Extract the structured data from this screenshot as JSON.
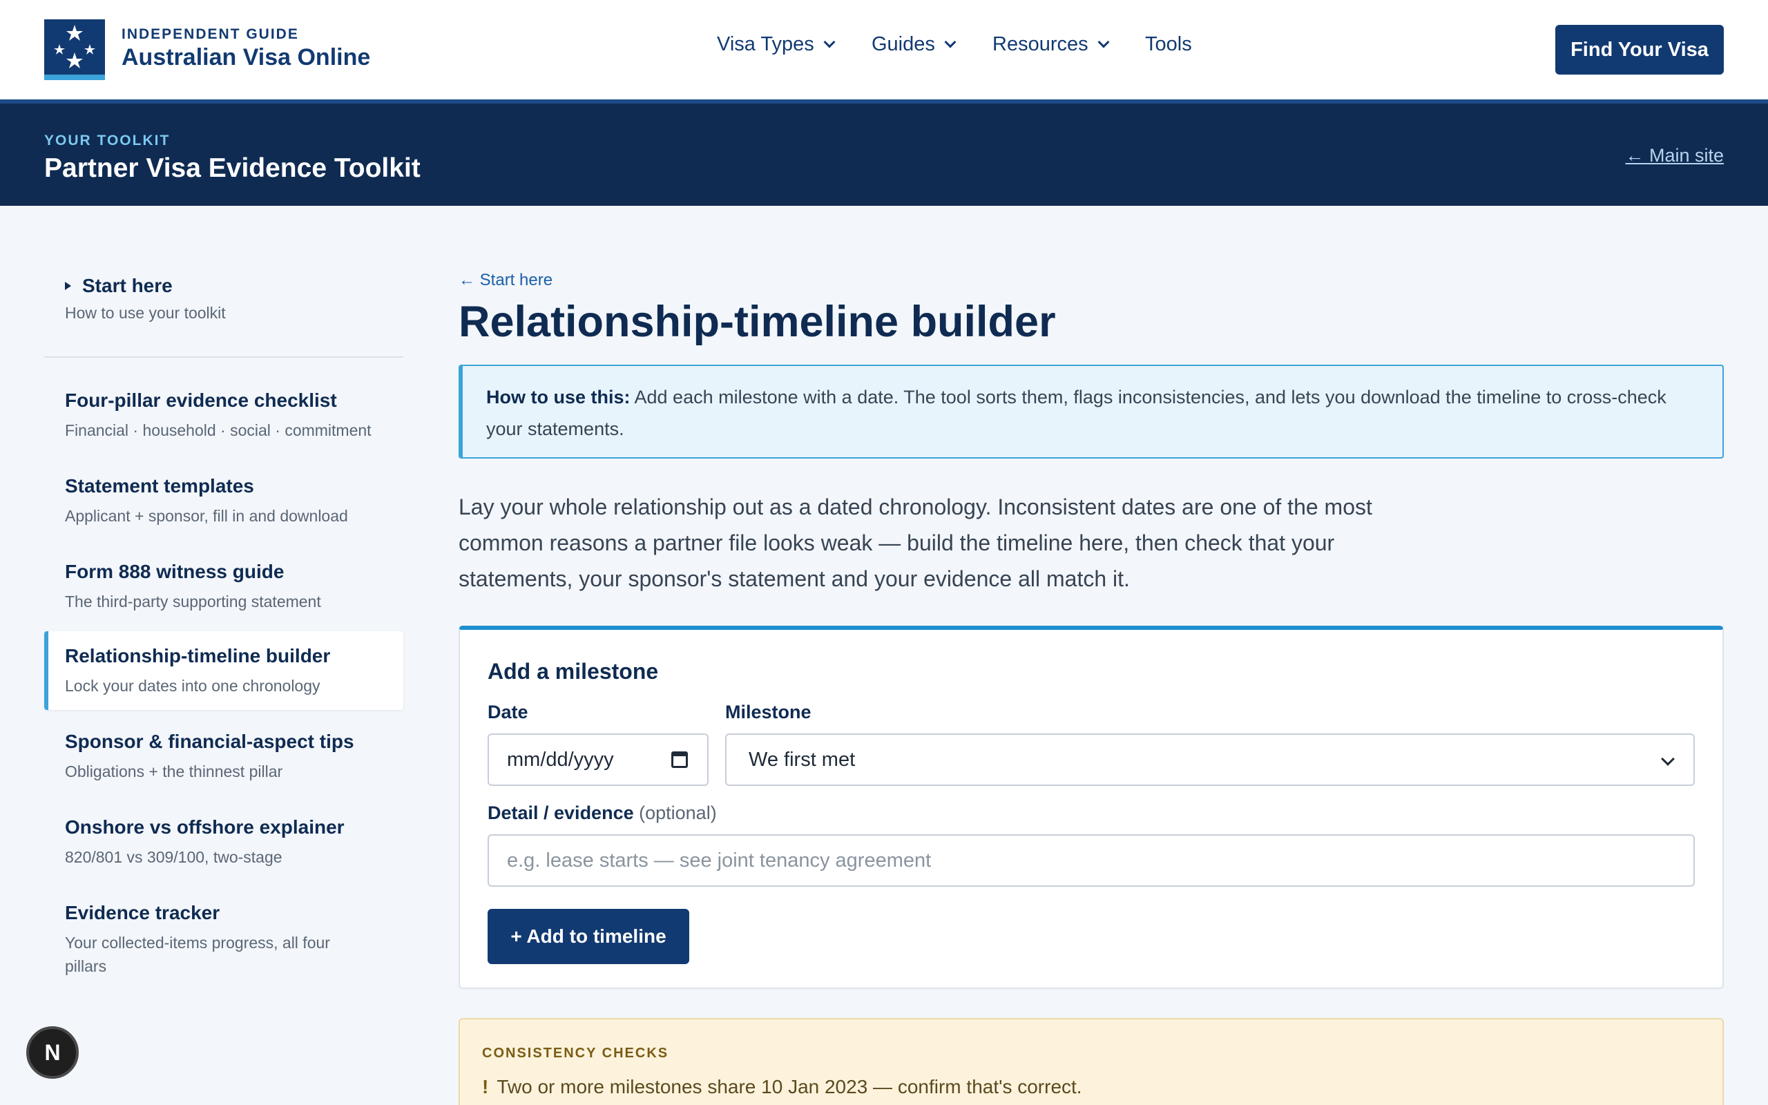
{
  "header": {
    "brand_kicker": "INDEPENDENT GUIDE",
    "brand_name": "Australian Visa Online",
    "nav": [
      {
        "label": "Visa Types",
        "has_menu": true
      },
      {
        "label": "Guides",
        "has_menu": true
      },
      {
        "label": "Resources",
        "has_menu": true
      },
      {
        "label": "Tools",
        "has_menu": false
      }
    ],
    "cta_label": "Find Your Visa"
  },
  "toolkit": {
    "kicker": "YOUR TOOLKIT",
    "title": "Partner Visa Evidence Toolkit",
    "back_link": "← Main site"
  },
  "sidebar": {
    "start": {
      "label": "Start here",
      "sub": "How to use your toolkit"
    },
    "items": [
      {
        "label": "Four-pillar evidence checklist",
        "sub": "Financial · household · social · commitment"
      },
      {
        "label": "Statement templates",
        "sub": "Applicant + sponsor, fill in and download"
      },
      {
        "label": "Form 888 witness guide",
        "sub": "The third-party supporting statement"
      },
      {
        "label": "Relationship-timeline builder",
        "sub": "Lock your dates into one chronology",
        "active": true
      },
      {
        "label": "Sponsor & financial-aspect tips",
        "sub": "Obligations + the thinnest pillar"
      },
      {
        "label": "Onshore vs offshore explainer",
        "sub": "820/801 vs 309/100, two-stage"
      },
      {
        "label": "Evidence tracker",
        "sub": "Your collected-items progress, all four pillars"
      }
    ]
  },
  "main": {
    "breadcrumb": "← Start here",
    "title": "Relationship-timeline builder",
    "howto_label": "How to use this:",
    "howto_text": "Add each milestone with a date. The tool sorts them, flags inconsistencies, and lets you download the timeline to cross-check your statements.",
    "intro": "Lay your whole relationship out as a dated chronology. Inconsistent dates are one of the most common reasons a partner file looks weak — build the timeline here, then check that your statements, your sponsor's statement and your evidence all match it."
  },
  "form": {
    "title": "Add a milestone",
    "date_label": "Date",
    "date_placeholder": "mm/dd/yyyy",
    "milestone_label": "Milestone",
    "milestone_value": "We first met",
    "detail_label": "Detail / evidence",
    "detail_optional": "(optional)",
    "detail_placeholder": "e.g. lease starts — see joint tenancy agreement",
    "add_button": "+ Add to timeline"
  },
  "checks": {
    "kicker": "CONSISTENCY CHECKS",
    "warnings": [
      {
        "icon": "!",
        "text": "Two or more milestones share 10 Jan 2023 — confirm that's correct."
      }
    ]
  },
  "floating": {
    "avatar_letter": "N"
  },
  "colors": {
    "navy": "#123a72",
    "toolkit_bar": "#0f2b52",
    "accent": "#3ba3d9",
    "warning_bg": "#fdf3dc"
  }
}
